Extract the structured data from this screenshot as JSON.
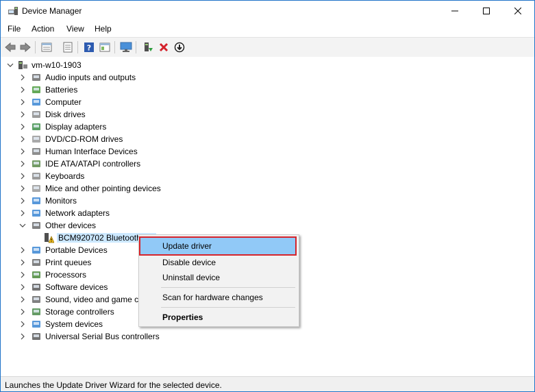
{
  "window": {
    "title": "Device Manager",
    "accent": "#1e73c8"
  },
  "menu": [
    "File",
    "Action",
    "View",
    "Help"
  ],
  "toolbar": {
    "icons": [
      "back-icon",
      "forward-icon",
      "properties-sheet-icon",
      "show-hidden-icon",
      "help-icon",
      "console-tree-icon",
      "monitor-icon",
      "update-driver-icon",
      "uninstall-icon",
      "disable-icon"
    ]
  },
  "tree": {
    "root": "vm-w10-1903",
    "items": [
      {
        "label": "Audio inputs and outputs",
        "icon": "speaker-icon"
      },
      {
        "label": "Batteries",
        "icon": "battery-icon"
      },
      {
        "label": "Computer",
        "icon": "computer-icon"
      },
      {
        "label": "Disk drives",
        "icon": "disk-drive-icon"
      },
      {
        "label": "Display adapters",
        "icon": "display-adapter-icon"
      },
      {
        "label": "DVD/CD-ROM drives",
        "icon": "dvd-drive-icon"
      },
      {
        "label": "Human Interface Devices",
        "icon": "hid-icon"
      },
      {
        "label": "IDE ATA/ATAPI controllers",
        "icon": "ide-controller-icon"
      },
      {
        "label": "Keyboards",
        "icon": "keyboard-icon"
      },
      {
        "label": "Mice and other pointing devices",
        "icon": "mouse-icon"
      },
      {
        "label": "Monitors",
        "icon": "monitor-icon"
      },
      {
        "label": "Network adapters",
        "icon": "network-adapter-icon"
      },
      {
        "label": "Other devices",
        "icon": "other-devices-icon",
        "expanded": true
      },
      {
        "label": "BCM920702 Bluetooth 4.0",
        "icon": "warning-device-icon",
        "child": true
      },
      {
        "label": "Portable Devices",
        "icon": "portable-device-icon"
      },
      {
        "label": "Print queues",
        "icon": "printer-icon"
      },
      {
        "label": "Processors",
        "icon": "processor-icon"
      },
      {
        "label": "Software devices",
        "icon": "software-device-icon"
      },
      {
        "label": "Sound, video and game controllers",
        "icon": "sound-icon"
      },
      {
        "label": "Storage controllers",
        "icon": "storage-controller-icon"
      },
      {
        "label": "System devices",
        "icon": "system-devices-icon"
      },
      {
        "label": "Universal Serial Bus controllers",
        "icon": "usb-icon"
      }
    ]
  },
  "context_menu": {
    "items": [
      "Update driver",
      "Disable device",
      "Uninstall device",
      "Scan for hardware changes",
      "Properties"
    ],
    "highlight_color": "#91c9f7",
    "outline_color": "#d6232a"
  },
  "status": "Launches the Update Driver Wizard for the selected device."
}
